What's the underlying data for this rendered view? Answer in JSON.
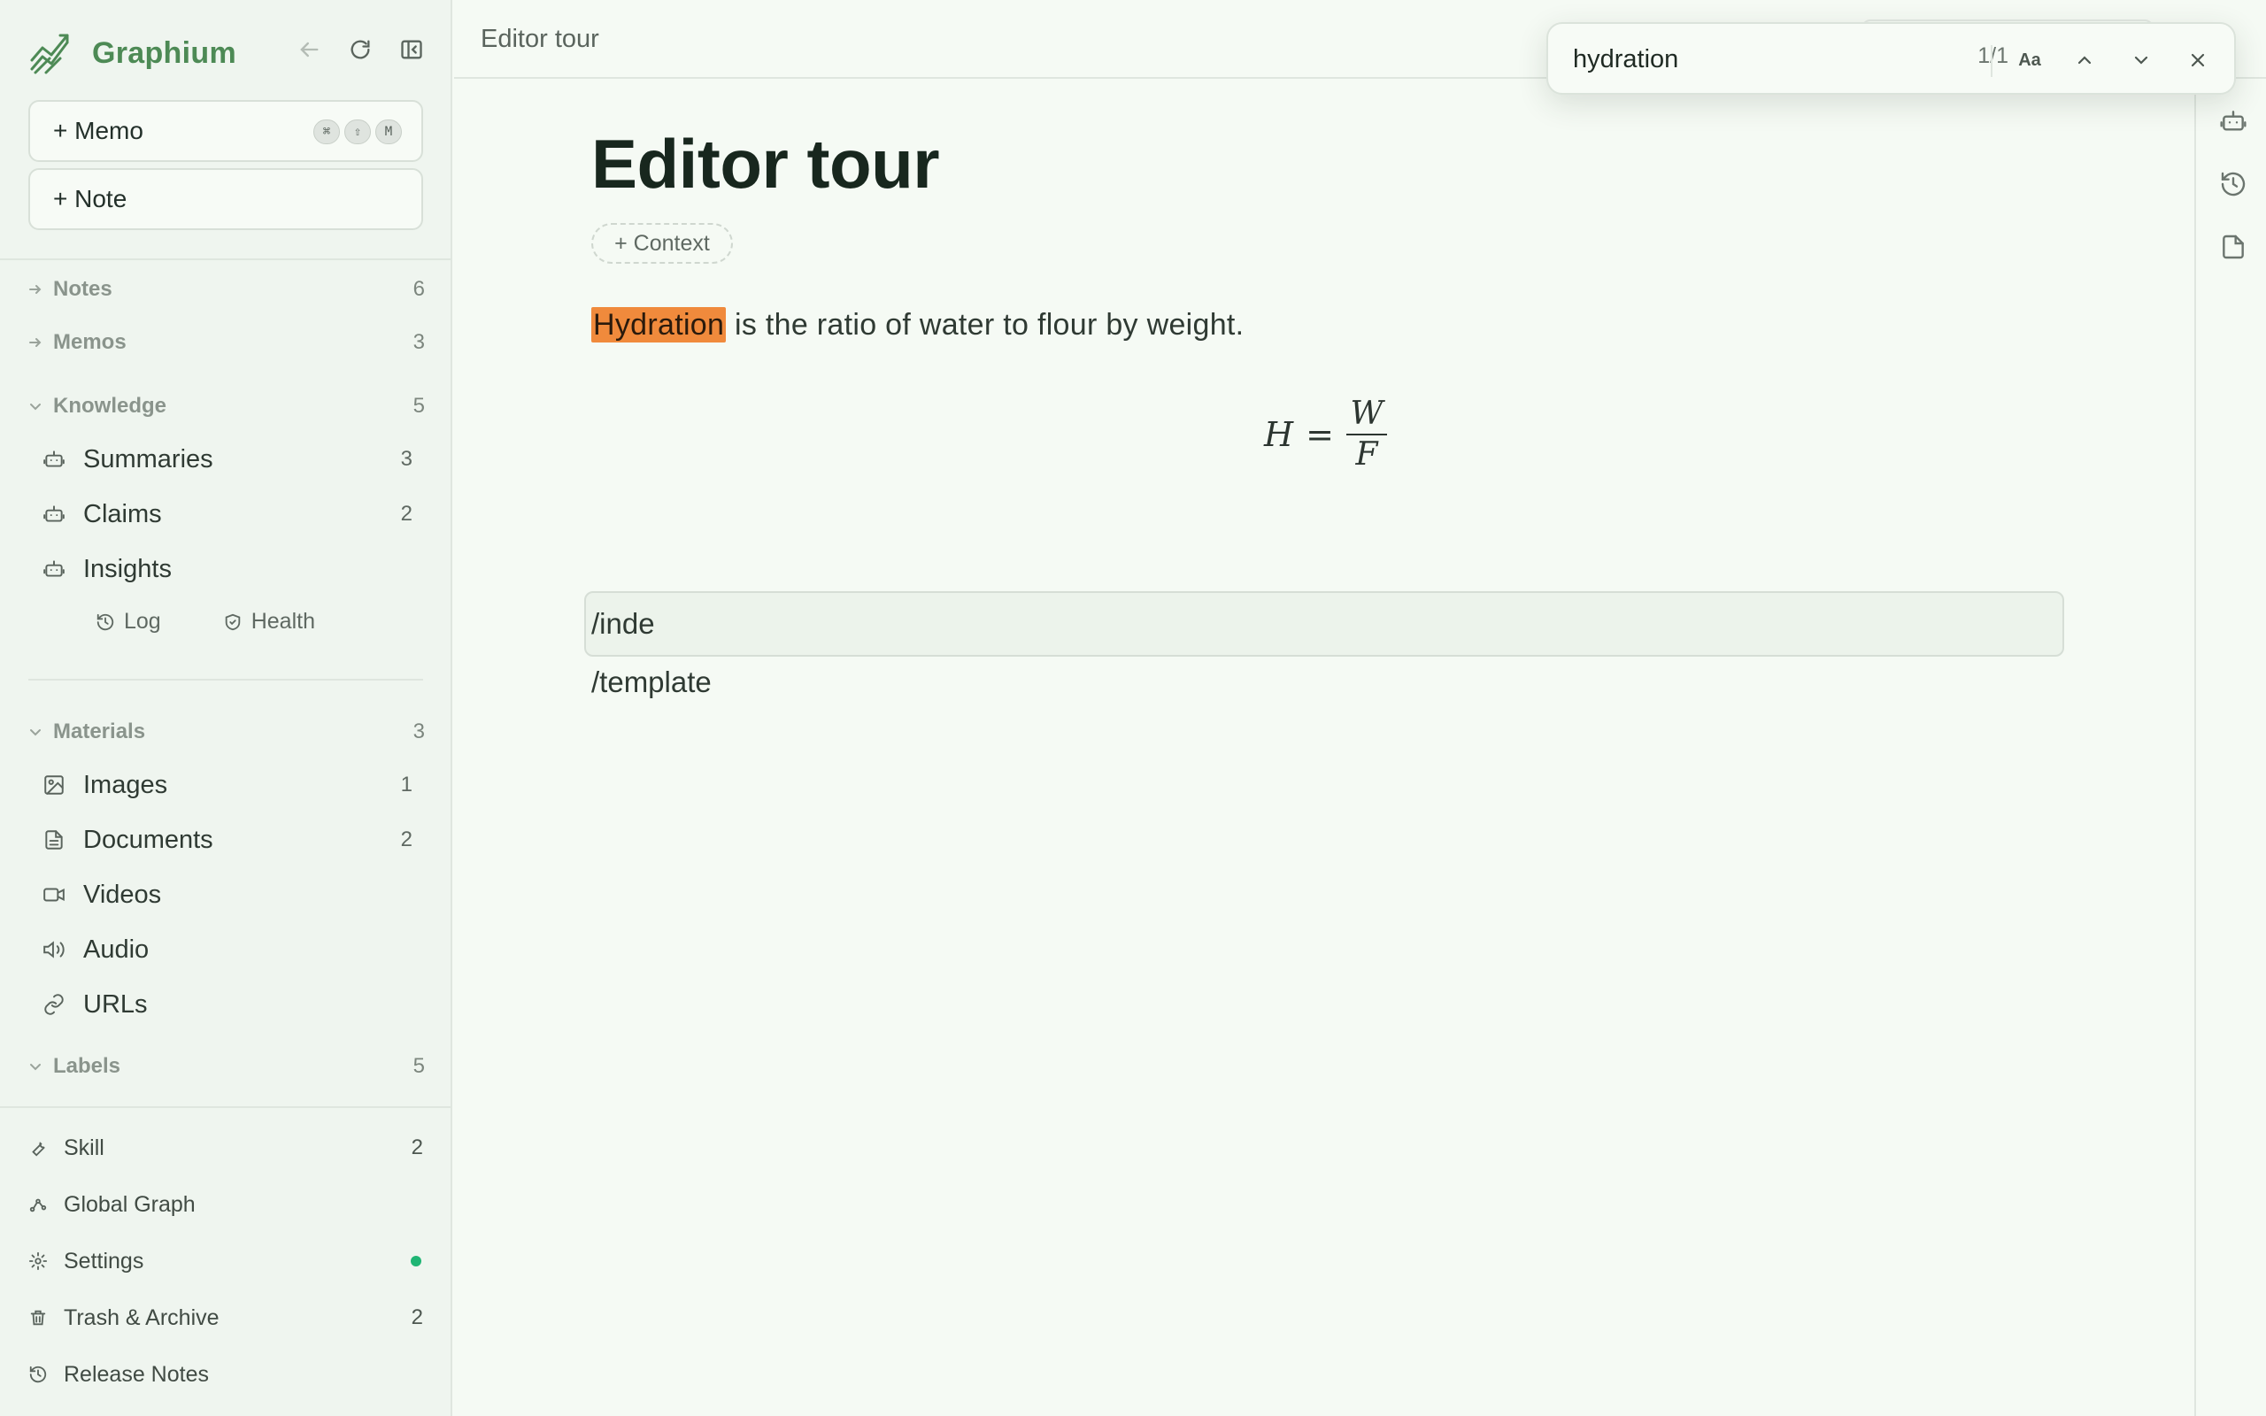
{
  "app": {
    "name": "Graphium",
    "brand_color": "#4d8a55",
    "highlight_color": "#f08a3c",
    "status_dot_color": "#1fb574"
  },
  "sidebar": {
    "memo_button": "+ Memo",
    "memo_shortcut": [
      "⌘",
      "⇧",
      "M"
    ],
    "note_button": "+ Note",
    "sections": {
      "notes": {
        "label": "Notes",
        "count": "6",
        "icon": "arrow-right-icon"
      },
      "memos": {
        "label": "Memos",
        "count": "3",
        "icon": "arrow-right-icon"
      },
      "knowledge": {
        "label": "Knowledge",
        "count": "5",
        "icon": "chevron-down-icon",
        "items": [
          {
            "label": "Summaries",
            "count": "3",
            "icon": "robot-icon"
          },
          {
            "label": "Claims",
            "count": "2",
            "icon": "robot-icon"
          },
          {
            "label": "Insights",
            "count": "",
            "icon": "robot-icon"
          }
        ],
        "sub_links": [
          {
            "label": "Log",
            "icon": "history-icon"
          },
          {
            "label": "Health",
            "icon": "shield-icon"
          }
        ]
      },
      "materials": {
        "label": "Materials",
        "count": "3",
        "icon": "chevron-down-icon",
        "items": [
          {
            "label": "Images",
            "count": "1",
            "icon": "image-icon"
          },
          {
            "label": "Documents",
            "count": "2",
            "icon": "document-icon"
          },
          {
            "label": "Videos",
            "count": "",
            "icon": "video-icon"
          },
          {
            "label": "Audio",
            "count": "",
            "icon": "speaker-icon"
          },
          {
            "label": "URLs",
            "count": "",
            "icon": "link-icon"
          }
        ]
      },
      "labels": {
        "label": "Labels",
        "count": "5",
        "icon": "chevron-down-icon"
      }
    },
    "footer": [
      {
        "label": "Skill",
        "count": "2",
        "icon": "wrench-icon"
      },
      {
        "label": "Global Graph",
        "count": "",
        "icon": "graph-icon"
      },
      {
        "label": "Settings",
        "count": "",
        "icon": "gear-icon"
      },
      {
        "label": "Trash & Archive",
        "count": "2",
        "icon": "trash-icon"
      },
      {
        "label": "Release Notes",
        "count": "",
        "icon": "history-icon"
      }
    ]
  },
  "topbar": {
    "breadcrumb": "Editor tour"
  },
  "find": {
    "query": "hydration",
    "count": "1/1",
    "case_label": "Aa"
  },
  "document": {
    "title": "Editor tour",
    "context_chip": "+ Context",
    "highlight_word": "Hydration",
    "paragraph_rest": " is the ratio of water to flour by weight.",
    "formula": {
      "lhs": "H",
      "eq": "=",
      "numerator": "W",
      "denominator": "F"
    },
    "slash_line_1": "/inde",
    "slash_line_2": "/template"
  },
  "right_rail": [
    "robot-icon",
    "history-icon",
    "document-icon"
  ]
}
